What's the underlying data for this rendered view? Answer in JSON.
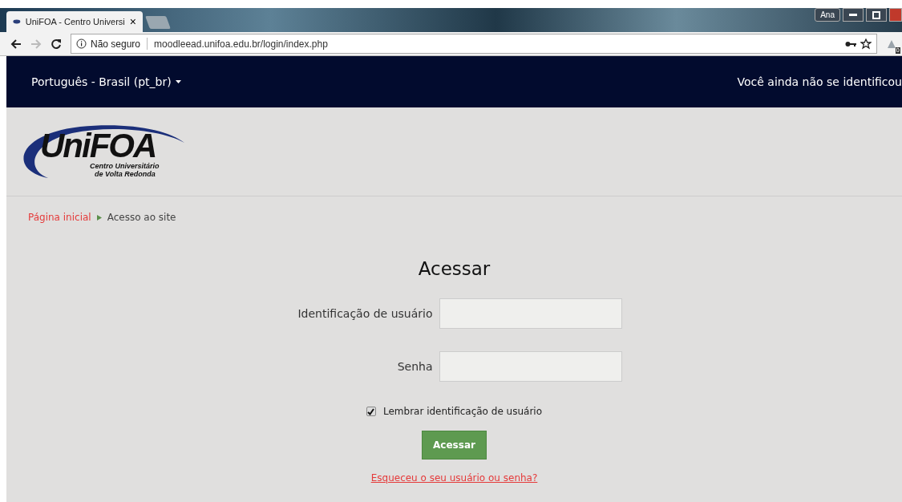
{
  "browser": {
    "tab": {
      "title": "UniFOA - Centro Universi",
      "close": "×"
    },
    "profile": "Ana",
    "address": {
      "security": "Não seguro",
      "url": "moodleead.unifoa.edu.br/login/index.php"
    },
    "extension_badge": "0"
  },
  "navbar": {
    "language": "Português - Brasil (pt_br)",
    "login_status": "Você ainda não se identificou"
  },
  "logo": {
    "name": "UniFOA",
    "subtitle": [
      "Centro Universitário",
      "de Volta Redonda"
    ]
  },
  "breadcrumb": [
    {
      "label": "Página inicial",
      "link": true
    },
    {
      "label": "Acesso ao site",
      "link": false
    }
  ],
  "login": {
    "title": "Acessar",
    "fields": [
      {
        "label": "Identificação de usuário"
      },
      {
        "label": "Senha"
      }
    ],
    "remember": {
      "label": "Lembrar identificação de usuário",
      "checked": true
    },
    "submit": "Acessar",
    "forgot": "Esqueceu o seu usuário ou senha?"
  }
}
